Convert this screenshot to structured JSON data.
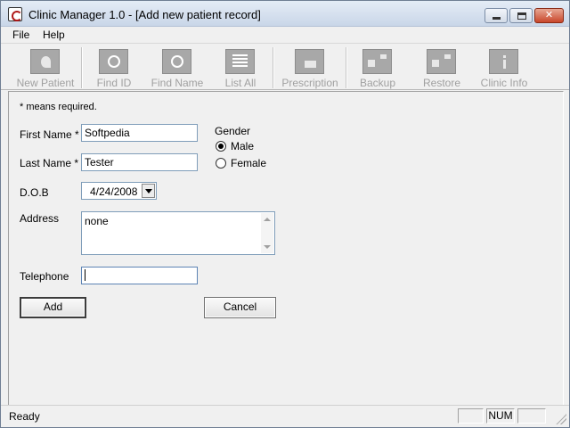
{
  "window": {
    "title": "Clinic Manager 1.0 - [Add new patient record]",
    "controls": {
      "minimize_icon": "minimize-icon",
      "maximize_icon": "maximize-icon",
      "close_icon": "close-icon"
    }
  },
  "menu": {
    "file": "File",
    "help": "Help"
  },
  "toolbar": {
    "new_patient": {
      "label": "New Patient",
      "icon": "new-patient-icon"
    },
    "find_id": {
      "label": "Find ID",
      "icon": "find-id-icon"
    },
    "find_name": {
      "label": "Find Name",
      "icon": "find-name-icon"
    },
    "list_all": {
      "label": "List All",
      "icon": "list-all-icon"
    },
    "prescription": {
      "label": "Prescription",
      "icon": "prescription-icon"
    },
    "backup": {
      "label": "Backup",
      "icon": "backup-icon"
    },
    "restore": {
      "label": "Restore",
      "icon": "restore-icon"
    },
    "clinic_info": {
      "label": "Clinic Info",
      "icon": "info-icon"
    }
  },
  "form": {
    "required_note": "* means required.",
    "first_name": {
      "label": "First Name *",
      "value": "Softpedia"
    },
    "last_name": {
      "label": "Last Name *",
      "value": "Tester"
    },
    "gender": {
      "label": "Gender",
      "options": [
        "Male",
        "Female"
      ],
      "selected": "Male"
    },
    "dob": {
      "label": "D.O.B",
      "value": "4/24/2008"
    },
    "address": {
      "label": "Address",
      "value": "none"
    },
    "telephone": {
      "label": "Telephone",
      "value": ""
    },
    "add_button": "Add",
    "cancel_button": "Cancel"
  },
  "status": {
    "text": "Ready",
    "num": "NUM"
  },
  "colors": {
    "window_bg": "#f0f0f0",
    "disabled_text": "#a0a0a0",
    "input_border": "#7f9db9",
    "close_button": "#c8462a"
  }
}
